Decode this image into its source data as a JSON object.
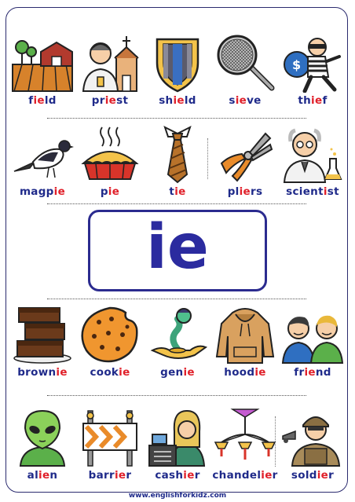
{
  "center": {
    "letters": "ie"
  },
  "footer": {
    "url": "www.englishforkidz.com"
  },
  "rows": [
    [
      {
        "pre": "f",
        "hl": "ie",
        "post": "ld",
        "icon": "field-icon"
      },
      {
        "pre": "pr",
        "hl": "ie",
        "post": "st",
        "icon": "priest-icon"
      },
      {
        "pre": "sh",
        "hl": "ie",
        "post": "ld",
        "icon": "shield-icon"
      },
      {
        "pre": "s",
        "hl": "ie",
        "post": "ve",
        "icon": "sieve-icon"
      },
      {
        "pre": "th",
        "hl": "ie",
        "post": "f",
        "icon": "thief-icon"
      }
    ],
    [
      {
        "pre": "magp",
        "hl": "ie",
        "post": "",
        "icon": "magpie-icon"
      },
      {
        "pre": "p",
        "hl": "ie",
        "post": "",
        "icon": "pie-icon"
      },
      {
        "pre": "t",
        "hl": "ie",
        "post": "",
        "icon": "tie-icon"
      },
      {
        "pre": "pl",
        "hl": "ie",
        "post": "rs",
        "icon": "pliers-icon"
      },
      {
        "pre": "scient",
        "hl": "i",
        "post": "st",
        "icon": "scientist-icon"
      }
    ],
    [
      {
        "pre": "brown",
        "hl": "ie",
        "post": "",
        "icon": "brownie-icon"
      },
      {
        "pre": "cook",
        "hl": "ie",
        "post": "",
        "icon": "cookie-icon"
      },
      {
        "pre": "gen",
        "hl": "ie",
        "post": "",
        "icon": "genie-icon"
      },
      {
        "pre": "hood",
        "hl": "ie",
        "post": "",
        "icon": "hoodie-icon"
      },
      {
        "pre": "fr",
        "hl": "ie",
        "post": "nd",
        "icon": "friend-icon"
      }
    ],
    [
      {
        "pre": "al",
        "hl": "ie",
        "post": "n",
        "icon": "alien-icon"
      },
      {
        "pre": "barr",
        "hl": "ie",
        "post": "r",
        "icon": "barrier-icon"
      },
      {
        "pre": "cash",
        "hl": "ie",
        "post": "r",
        "icon": "cashier-icon"
      },
      {
        "pre": "chandel",
        "hl": "ie",
        "post": "r",
        "icon": "chandelier-icon"
      },
      {
        "pre": "sold",
        "hl": "ie",
        "post": "r",
        "icon": "soldier-icon"
      }
    ]
  ]
}
